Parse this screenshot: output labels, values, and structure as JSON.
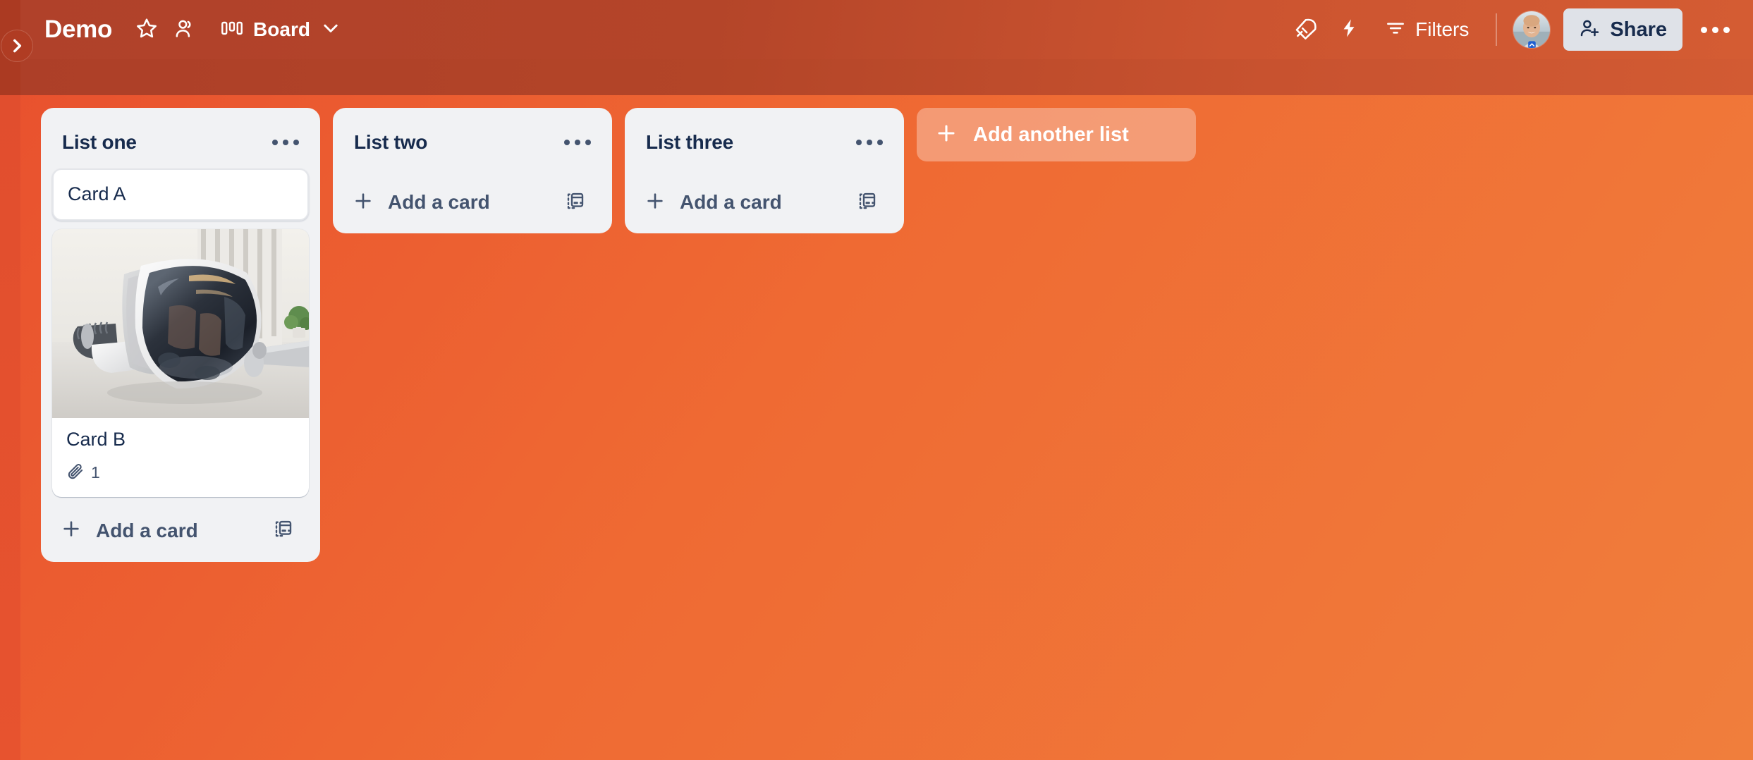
{
  "header": {
    "sidebar_toggle_icon": "chevron-right-icon",
    "board_title": "Demo",
    "star_icon": "star-icon",
    "members_icon": "members-icon",
    "board_view_icon": "board-view-icon",
    "view_label": "Board",
    "view_chevron_icon": "chevron-down-icon",
    "rocket_icon": "rocket-icon",
    "automation_icon": "lightning-bolt-icon",
    "filters_icon": "filter-icon",
    "filters_label": "Filters",
    "avatar_name": "avatar",
    "share_icon": "person-add-icon",
    "share_label": "Share",
    "more_icon": "more-horizontal-icon"
  },
  "board": {
    "background_color": "#ef6a33",
    "list_background_color": "#f1f2f4",
    "text_color": "#172b4d",
    "muted_text_color": "#44546f",
    "lists": [
      {
        "title": "List one",
        "menu_icon": "more-horizontal-icon",
        "add_card_label": "Add a card",
        "add_card_icon": "plus-icon",
        "template_icon": "card-template-icon",
        "cards": [
          {
            "title": "Card A",
            "selected": true,
            "has_cover": false,
            "attachment_icon": "",
            "attachment_count": ""
          },
          {
            "title": "Card B",
            "selected": false,
            "has_cover": true,
            "cover_alt": "vr-headset-on-desk",
            "attachment_icon": "attachment-icon",
            "attachment_count": "1"
          }
        ]
      },
      {
        "title": "List two",
        "menu_icon": "more-horizontal-icon",
        "add_card_label": "Add a card",
        "add_card_icon": "plus-icon",
        "template_icon": "card-template-icon",
        "cards": []
      },
      {
        "title": "List three",
        "menu_icon": "more-horizontal-icon",
        "add_card_label": "Add a card",
        "add_card_icon": "plus-icon",
        "template_icon": "card-template-icon",
        "cards": []
      }
    ],
    "add_list_label": "Add another list",
    "add_list_icon": "plus-icon"
  }
}
